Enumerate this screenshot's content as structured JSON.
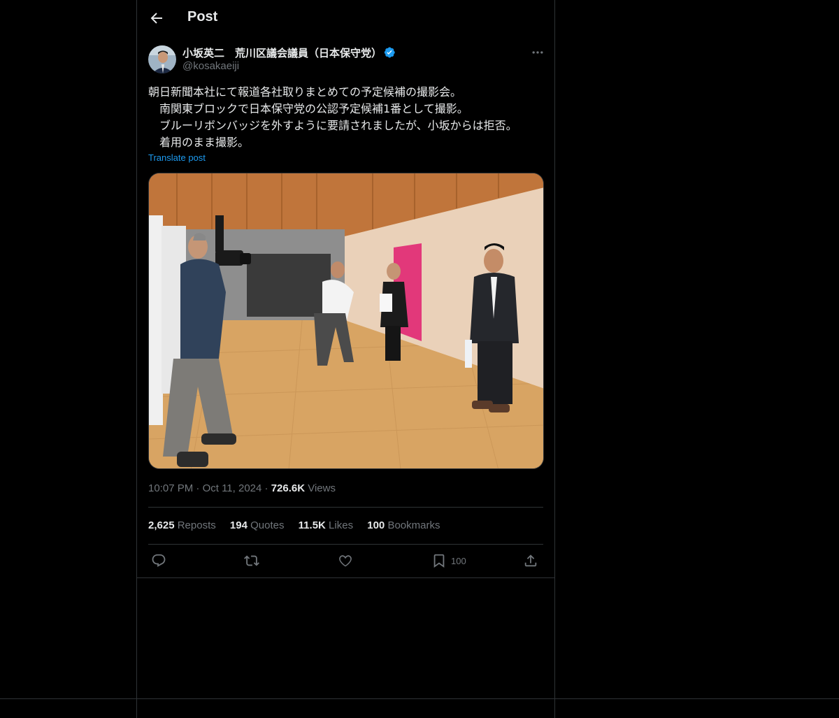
{
  "header": {
    "title": "Post"
  },
  "post": {
    "author_name": "小坂英二　荒川区議会議員（日本保守党）",
    "handle": "@kosakaeiji",
    "text": "朝日新聞本社にて報道各社取りまとめての予定候補の撮影会。\n　南関東ブロックで日本保守党の公認予定候補1番として撮影。\n　ブルーリボンバッジを外すように要請されましたが、小坂からは拒否。\n　着用のまま撮影。",
    "translate_label": "Translate post",
    "time": "10:07 PM",
    "date": "Oct 11, 2024",
    "views_count": "726.6K",
    "views_label": "Views",
    "separator": "·"
  },
  "stats": [
    {
      "count": "2,625",
      "label": "Reposts"
    },
    {
      "count": "194",
      "label": "Quotes"
    },
    {
      "count": "11.5K",
      "label": "Likes"
    },
    {
      "count": "100",
      "label": "Bookmarks"
    }
  ],
  "actions": {
    "bookmark_count": "100",
    "icons": [
      "reply-icon",
      "repost-icon",
      "like-icon",
      "bookmark-icon",
      "share-icon"
    ]
  },
  "colors": {
    "background": "#000000",
    "border": "#2f3336",
    "text": "#e7e9ea",
    "muted": "#71767b",
    "accent": "#1d9bf0"
  }
}
